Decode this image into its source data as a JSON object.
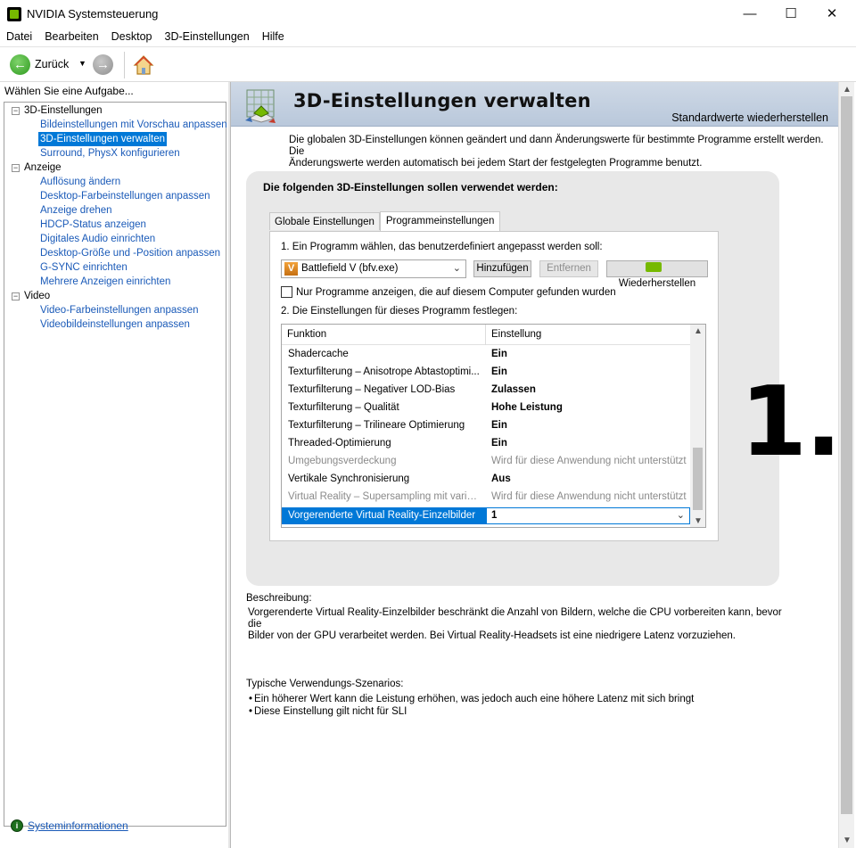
{
  "window": {
    "title": "NVIDIA Systemsteuerung",
    "minimize": "—",
    "maximize": "☐",
    "close": "✕"
  },
  "menu": [
    "Datei",
    "Bearbeiten",
    "Desktop",
    "3D-Einstellungen",
    "Hilfe"
  ],
  "toolbar": {
    "back_label": "Zurück"
  },
  "sidebar": {
    "header": "Wählen Sie eine Aufgabe...",
    "groups": [
      {
        "label": "3D-Einstellungen",
        "items": [
          "Bildeinstellungen mit Vorschau anpassen",
          "3D-Einstellungen verwalten",
          "Surround, PhysX konfigurieren"
        ]
      },
      {
        "label": "Anzeige",
        "items": [
          "Auflösung ändern",
          "Desktop-Farbeinstellungen anpassen",
          "Anzeige drehen",
          "HDCP-Status anzeigen",
          "Digitales Audio einrichten",
          "Desktop-Größe und -Position anpassen",
          "G-SYNC einrichten",
          "Mehrere Anzeigen einrichten"
        ]
      },
      {
        "label": "Video",
        "items": [
          "Video-Farbeinstellungen anpassen",
          "Videobildeinstellungen anpassen"
        ]
      }
    ],
    "selected_item": "3D-Einstellungen verwalten",
    "system_info": "Systeminformationen"
  },
  "page": {
    "title": "3D-Einstellungen verwalten",
    "restore_defaults": "Standardwerte wiederherstellen",
    "intro_line1": "Die globalen 3D-Einstellungen können geändert und dann Änderungswerte für bestimmte Programme erstellt werden. Die",
    "intro_line2": "Änderungswerte werden automatisch bei jedem Start der festgelegten Programme benutzt.",
    "panel_heading": "Die folgenden 3D-Einstellungen sollen verwendet werden:",
    "tabs": [
      "Globale Einstellungen",
      "Programmeinstellungen"
    ],
    "active_tab": "Programmeinstellungen",
    "step1": "1. Ein Programm wählen, das benutzerdefiniert angepasst werden soll:",
    "program_selected": "Battlefield V (bfv.exe)",
    "program_icon_letter": "V",
    "btn_add": "Hinzufügen",
    "btn_remove": "Entfernen",
    "btn_restore": "Wiederherstellen",
    "checkbox_label": "Nur Programme anzeigen, die auf diesem Computer gefunden wurden",
    "checkbox_checked": false,
    "step2": "2. Die Einstellungen für dieses Programm festlegen:",
    "grid_headers": [
      "Funktion",
      "Einstellung"
    ],
    "grid_rows": [
      {
        "feature": "Shadercache",
        "value": "Ein",
        "style": "bold"
      },
      {
        "feature": "Texturfilterung – Anisotrope Abtastoptimi...",
        "value": "Ein",
        "style": "bold"
      },
      {
        "feature": "Texturfilterung – Negativer LOD-Bias",
        "value": "Zulassen",
        "style": "bold"
      },
      {
        "feature": "Texturfilterung – Qualität",
        "value": "Hohe Leistung",
        "style": "bold"
      },
      {
        "feature": "Texturfilterung – Trilineare Optimierung",
        "value": "Ein",
        "style": "bold"
      },
      {
        "feature": "Threaded-Optimierung",
        "value": "Ein",
        "style": "bold"
      },
      {
        "feature": "Umgebungsverdeckung",
        "value": "Wird für diese Anwendung nicht unterstützt",
        "style": "grey"
      },
      {
        "feature": "Vertikale Synchronisierung",
        "value": "Aus",
        "style": "bold"
      },
      {
        "feature": "Virtual Reality – Supersampling mit variabl...",
        "value": "Wird für diese Anwendung nicht unterstützt",
        "style": "grey"
      }
    ],
    "selected_row": {
      "feature": "Vorgerenderte Virtual Reality-Einzelbilder",
      "value": "1"
    },
    "description_title": "Beschreibung:",
    "description_line1": "Vorgerenderte Virtual Reality-Einzelbilder beschränkt die Anzahl von Bildern, welche die CPU vorbereiten kann, bevor die",
    "description_line2": "Bilder von der GPU verarbeitet werden. Bei Virtual Reality-Headsets ist eine niedrigere Latenz vorzuziehen.",
    "usage_title": "Typische Verwendungs-Szenarios:",
    "usage_items": [
      "Ein höherer Wert kann die Leistung erhöhen, was jedoch auch eine höhere Latenz mit sich bringt",
      "Diese Einstellung gilt nicht für SLI"
    ]
  },
  "annotation": "1.",
  "colors": {
    "accent": "#0078d7",
    "nvidia_green": "#76b900",
    "link": "#1a5ab8",
    "banner": "#c4d1e1"
  },
  "icons": {
    "app": "nvidia-app-icon",
    "back": "back-arrow-icon",
    "forward": "forward-arrow-icon",
    "home": "home-icon",
    "banner": "3d-settings-icon",
    "system_info": "system-info-icon"
  }
}
